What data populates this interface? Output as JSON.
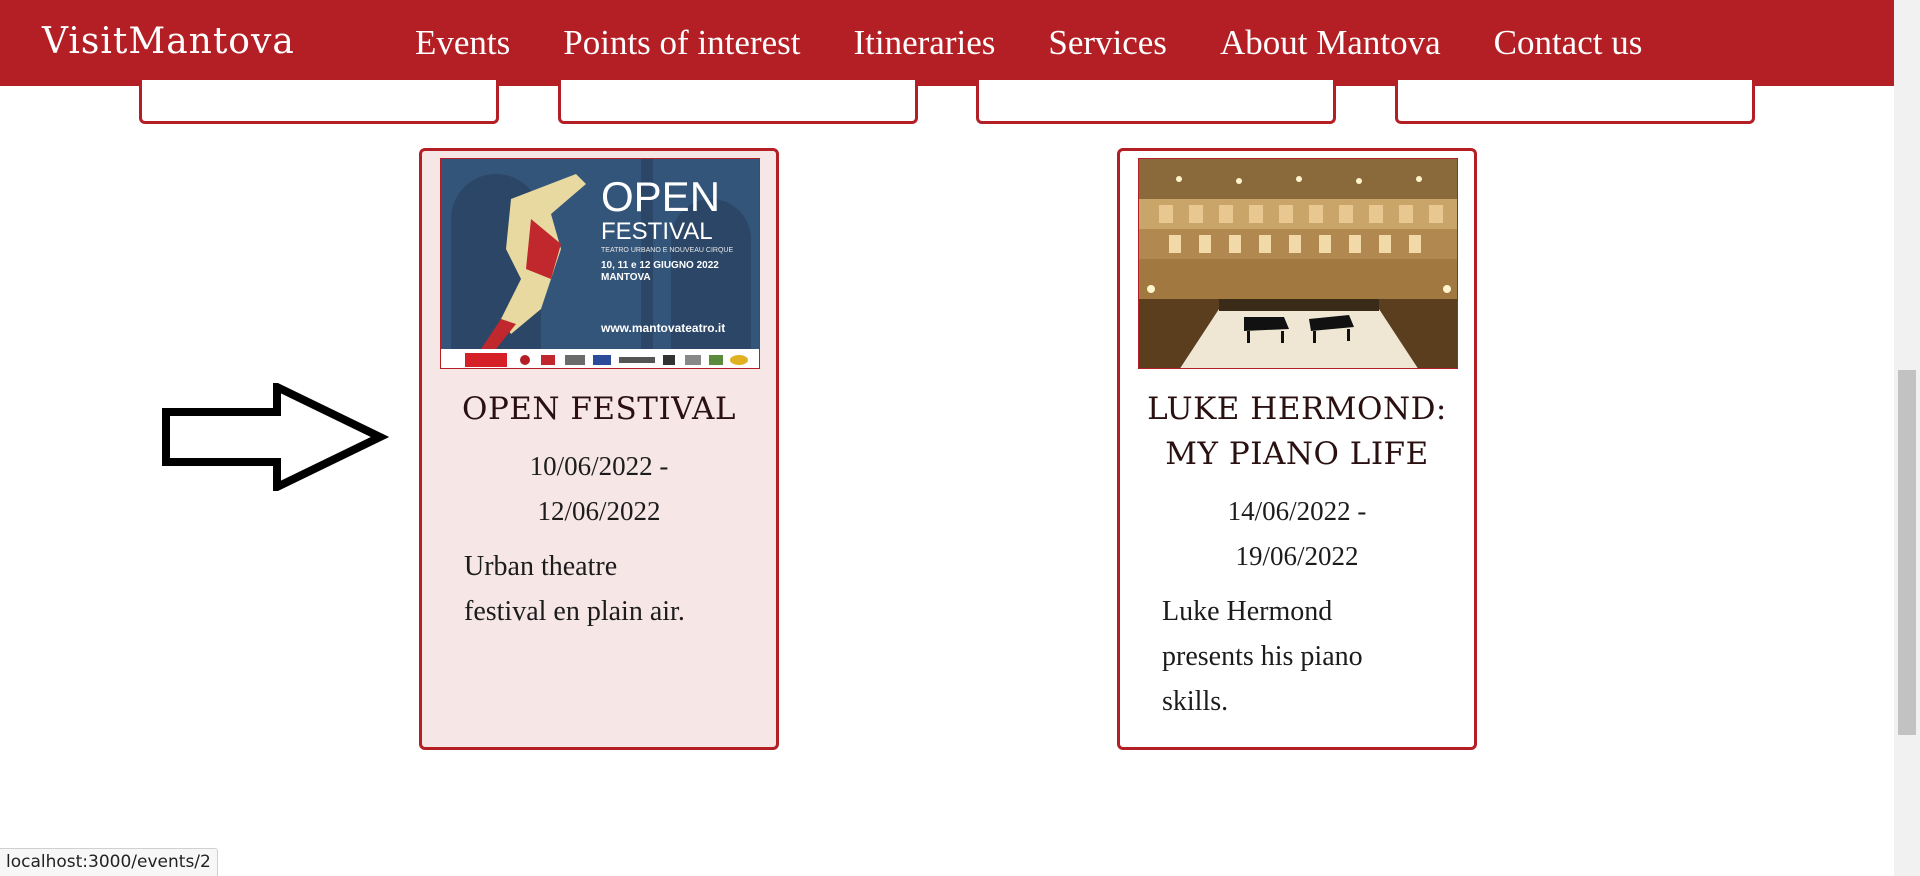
{
  "nav": {
    "logo": "VisitMantova",
    "items": [
      "Events",
      "Points of interest",
      "Itineraries",
      "Services",
      "About Mantova",
      "Contact us"
    ]
  },
  "cards": [
    {
      "title": "OPEN FESTIVAL",
      "date_start": "10/06/2022 -",
      "date_end": "12/06/2022",
      "desc_lines": [
        "Urban theatre",
        "festival en plain air."
      ],
      "poster": {
        "headline": "OPEN",
        "subhead": "FESTIVAL",
        "tagline": "TEATRO URBANO E NOUVEAU CIRQUE",
        "dates": "10, 11 e 12 GIUGNO 2022",
        "city": "MANTOVA",
        "site": "www.mantovateatro.it"
      }
    },
    {
      "title_lines": [
        "LUKE HERMOND:",
        "MY PIANO LIFE"
      ],
      "date_start": "14/06/2022 -",
      "date_end": "19/06/2022",
      "desc_lines": [
        "Luke Hermond",
        "presents his piano",
        "skills."
      ]
    }
  ],
  "status_url": "localhost:3000/events/2",
  "colors": {
    "brand": "#b31f24",
    "highlight_bg": "#f6e6e6"
  }
}
